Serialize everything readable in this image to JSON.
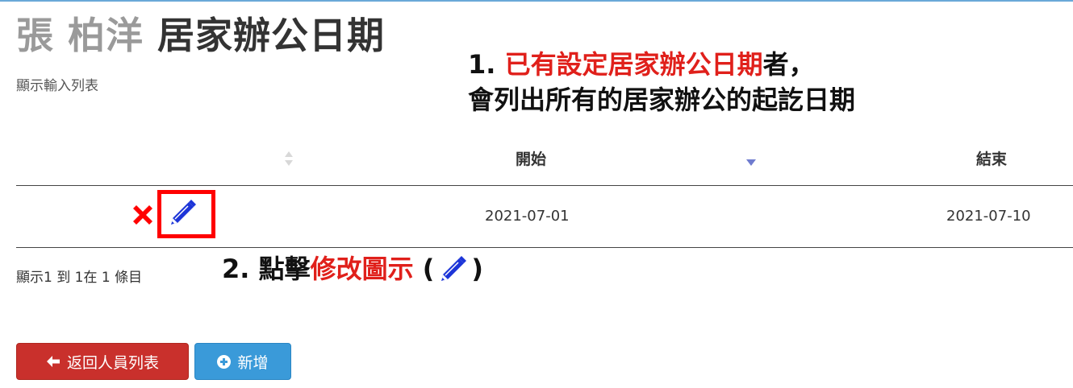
{
  "header": {
    "name": "張 柏洋",
    "title_rest": "居家辦公日期",
    "subtitle": "顯示輸入列表"
  },
  "annotation1": {
    "line1_number": "1.",
    "line1_highlight": "已有設定居家辦公日期",
    "line1_suffix": "者，",
    "line2": "會列出所有的居家辦公的起訖日期"
  },
  "table": {
    "columns": [
      "",
      "開始",
      "結束"
    ],
    "sort": {
      "actions": "none",
      "start": "descending"
    },
    "rows": [
      {
        "start": "2021-07-01",
        "end": "2021-07-10",
        "actions": [
          "delete-icon",
          "pencil-icon"
        ]
      }
    ]
  },
  "pagination": {
    "info": "顯示1 到 1在 1 條目"
  },
  "annotation2": {
    "number_text": "2. 點擊",
    "highlight": "修改圖示",
    "open_paren": " (",
    "close_paren": ")"
  },
  "buttons": {
    "back_label": "返回人員列表",
    "add_label": "新增"
  },
  "colors": {
    "annotation_red": "#e0201b",
    "highlight_box": "#ff0000",
    "edit_icon": "#1d35d8",
    "delete_icon": "#ff0000",
    "back_button": "#c9302c",
    "add_button": "#3a9ad9",
    "sort_indicator": "#6f7ccf"
  }
}
